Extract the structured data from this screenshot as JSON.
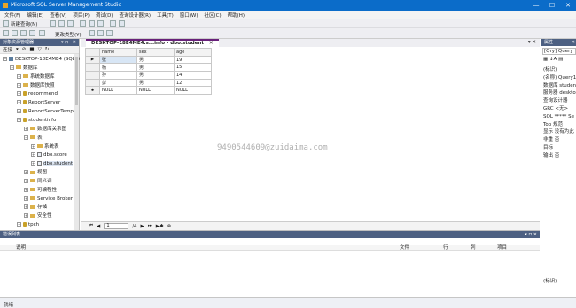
{
  "window": {
    "title": "Microsoft SQL Server Management Studio",
    "minimize": "—",
    "maximize": "☐",
    "close": "✕"
  },
  "menu": [
    "文件(F)",
    "编辑(E)",
    "查看(V)",
    "项目(P)",
    "调试(D)",
    "查询设计器(R)",
    "工具(T)",
    "窗口(W)",
    "社区(C)",
    "帮助(H)"
  ],
  "toolbar": {
    "new_query": "新建查询(N)",
    "change_type": "更改类型(Y)"
  },
  "object_explorer": {
    "title": "对象资源管理器",
    "connect": "连接",
    "tree": [
      {
        "label": "DESKTOP-18E4ME4 (SQL S",
        "indent": 0,
        "expander": "−",
        "icon": "server-icon"
      },
      {
        "label": "数据库",
        "indent": 1,
        "expander": "−",
        "icon": "folder-icon"
      },
      {
        "label": "系统数据库",
        "indent": 2,
        "expander": "+",
        "icon": "folder-icon"
      },
      {
        "label": "数据库快照",
        "indent": 2,
        "expander": "+",
        "icon": "folder-icon"
      },
      {
        "label": "recommend",
        "indent": 2,
        "expander": "+",
        "icon": "database-icon"
      },
      {
        "label": "ReportServer",
        "indent": 2,
        "expander": "+",
        "icon": "database-icon"
      },
      {
        "label": "ReportServerTempD",
        "indent": 2,
        "expander": "+",
        "icon": "database-icon"
      },
      {
        "label": "studentinfo",
        "indent": 2,
        "expander": "−",
        "icon": "database-icon"
      },
      {
        "label": "数据库关系图",
        "indent": 3,
        "expander": "+",
        "icon": "folder-icon"
      },
      {
        "label": "表",
        "indent": 3,
        "expander": "−",
        "icon": "folder-icon"
      },
      {
        "label": "系统表",
        "indent": 4,
        "expander": "+",
        "icon": "folder-icon"
      },
      {
        "label": "dbo.score",
        "indent": 4,
        "expander": "+",
        "icon": "table-icon"
      },
      {
        "label": "dbo.student",
        "indent": 4,
        "expander": "+",
        "icon": "table-icon"
      },
      {
        "label": "视图",
        "indent": 3,
        "expander": "+",
        "icon": "folder-icon"
      },
      {
        "label": "同义词",
        "indent": 3,
        "expander": "+",
        "icon": "folder-icon"
      },
      {
        "label": "可编程性",
        "indent": 3,
        "expander": "+",
        "icon": "folder-icon"
      },
      {
        "label": "Service Broker",
        "indent": 3,
        "expander": "+",
        "icon": "folder-icon"
      },
      {
        "label": "存储",
        "indent": 3,
        "expander": "+",
        "icon": "folder-icon"
      },
      {
        "label": "安全性",
        "indent": 3,
        "expander": "+",
        "icon": "folder-icon"
      },
      {
        "label": "tpch",
        "indent": 2,
        "expander": "+",
        "icon": "database-icon"
      },
      {
        "label": "安全性",
        "indent": 1,
        "expander": "+",
        "icon": "folder-icon"
      },
      {
        "label": "服务器对象",
        "indent": 1,
        "expander": "+",
        "icon": "folder-icon"
      }
    ]
  },
  "editor": {
    "tab_label": "DESKTOP-18E4ME4.s...info - dbo.student",
    "columns": [
      "name",
      "sex",
      "age"
    ],
    "rows": [
      {
        "marker": "▶",
        "cells": [
          "张",
          "男",
          "19"
        ]
      },
      {
        "marker": "",
        "cells": [
          "杨",
          "男",
          "15"
        ]
      },
      {
        "marker": "",
        "cells": [
          "孙",
          "男",
          "14"
        ]
      },
      {
        "marker": "",
        "cells": [
          "彭",
          "男",
          "12"
        ]
      },
      {
        "marker": "✱",
        "cells": [
          "NULL",
          "NULL",
          "NULL"
        ]
      }
    ],
    "nav_current": "1",
    "nav_total": "/4"
  },
  "properties": {
    "title": "属性",
    "selector": "[Qry] Query",
    "rows": [
      "(标识)",
      "(名称) Query1",
      "数据库 studentin",
      "服务器 desktop",
      "查询设计器",
      "GRC <无>",
      "SQL ***** Se",
      "Top 规范",
      "显示 没有为此",
      "非重 否",
      "目标",
      "输出 否"
    ],
    "footer": "(标识)"
  },
  "error_list": {
    "title": "错误列表",
    "columns": [
      "说明",
      "文件",
      "行",
      "列",
      "项目"
    ]
  },
  "status": {
    "text": "就绪"
  },
  "watermark": "9490544609@zuidaima.com",
  "colors": {
    "title_bar": "#0b6cc9",
    "pane_header": "#4d6082",
    "tab_accent": "#68217a"
  }
}
